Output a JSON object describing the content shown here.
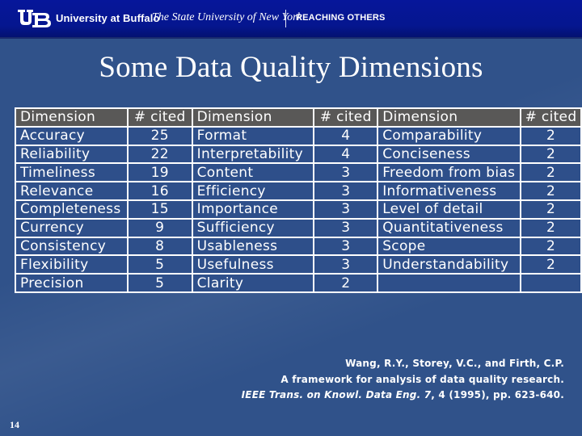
{
  "header": {
    "logo": "ub-logo",
    "university_name": "University at Buffalo",
    "subtitle": "The State University of New York",
    "tagline": "REACHING OTHERS",
    "colors": {
      "bar": "#06169a",
      "slide_bg": "#30528a",
      "table_header": "#595857",
      "table_cell": "#2e4f8a"
    }
  },
  "slide": {
    "title": "Some Data Quality Dimensions",
    "number": "14"
  },
  "table": {
    "headers": [
      "Dimension",
      "# cited",
      "Dimension",
      "# cited",
      "Dimension",
      "# cited"
    ],
    "rows": [
      [
        "Accuracy",
        "25",
        "Format",
        "4",
        "Comparability",
        "2"
      ],
      [
        "Reliability",
        "22",
        "Interpretability",
        "4",
        "Conciseness",
        "2"
      ],
      [
        "Timeliness",
        "19",
        "Content",
        "3",
        "Freedom from bias",
        "2"
      ],
      [
        "Relevance",
        "16",
        "Efficiency",
        "3",
        "Informativeness",
        "2"
      ],
      [
        "Completeness",
        "15",
        "Importance",
        "3",
        "Level of detail",
        "2"
      ],
      [
        "Currency",
        "9",
        "Sufficiency",
        "3",
        "Quantitativeness",
        "2"
      ],
      [
        "Consistency",
        "8",
        "Usableness",
        "3",
        "Scope",
        "2"
      ],
      [
        "Flexibility",
        "5",
        "Usefulness",
        "3",
        "Understandability",
        "2"
      ],
      [
        "Precision",
        "5",
        "Clarity",
        "2",
        "",
        ""
      ]
    ]
  },
  "citation": {
    "line1": "Wang, R.Y., Storey, V.C., and Firth, C.P.",
    "line2": "A framework for analysis of data quality research.",
    "line3_italic": "IEEE Trans. on Knowl. Data Eng. 7",
    "line3_rest": ", 4 (1995), pp. 623-640."
  }
}
